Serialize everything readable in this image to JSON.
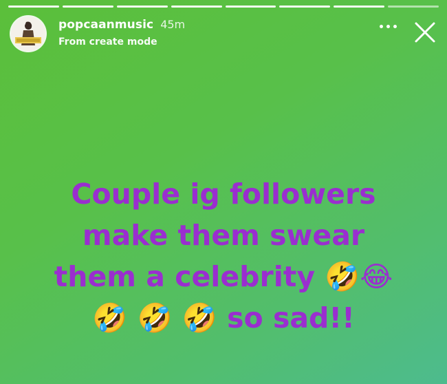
{
  "story": {
    "progress_segments": 8,
    "username": "popcaanmusic",
    "time": "45m",
    "subtitle": "From create mode",
    "text_lines": [
      "Couple ig followers",
      "make them swear",
      "them a celebrity 🤣😂",
      "🤣 🤣 🤣 so sad!!"
    ]
  },
  "controls": {
    "more_icon": "more-horizontal-icon",
    "close_icon": "close-icon"
  },
  "colors": {
    "text_purple": "#9a2ecf",
    "bg_green": "#58c04a"
  }
}
